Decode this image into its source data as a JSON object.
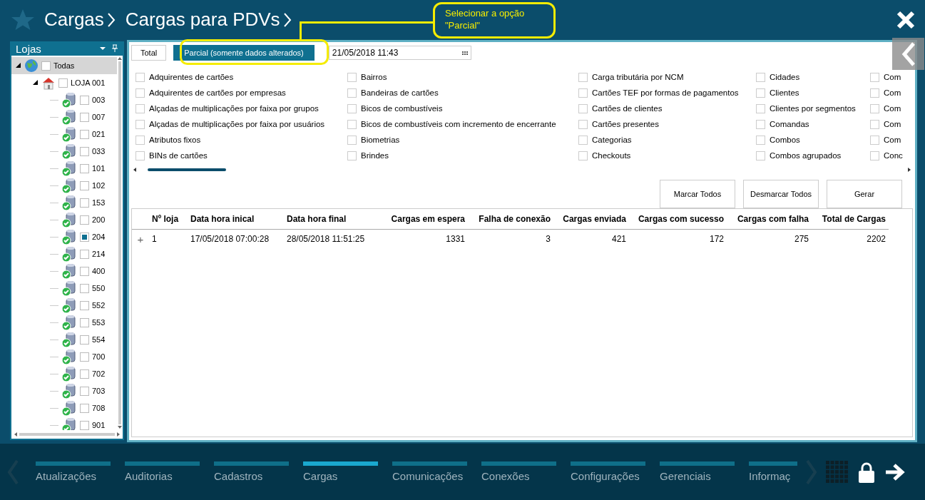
{
  "header": {
    "breadcrumbs": [
      "Cargas",
      "Cargas para PDVs"
    ]
  },
  "callout": {
    "text": "Selecionar a opção\n\"Parcial\""
  },
  "sidebar": {
    "title": "Lojas",
    "tree": [
      {
        "label": "Todas",
        "kind": "globe",
        "checked": false,
        "selected": true,
        "expanded": true,
        "children": [
          {
            "label": "LOJA 001",
            "kind": "house",
            "checked": false,
            "selected": false,
            "expanded": true,
            "children": [
              {
                "label": "003",
                "kind": "pdv",
                "checked": false,
                "selected": false
              },
              {
                "label": "007",
                "kind": "pdv",
                "checked": false,
                "selected": false
              },
              {
                "label": "021",
                "kind": "pdv",
                "checked": false,
                "selected": false
              },
              {
                "label": "033",
                "kind": "pdv",
                "checked": false,
                "selected": false
              },
              {
                "label": "101",
                "kind": "pdv",
                "checked": false,
                "selected": false
              },
              {
                "label": "102",
                "kind": "pdv",
                "checked": false,
                "selected": false
              },
              {
                "label": "153",
                "kind": "pdv",
                "checked": false,
                "selected": false
              },
              {
                "label": "200",
                "kind": "pdv",
                "checked": false,
                "selected": false
              },
              {
                "label": "204",
                "kind": "pdv",
                "checked": true,
                "selected": false
              },
              {
                "label": "214",
                "kind": "pdv",
                "checked": false,
                "selected": false
              },
              {
                "label": "400",
                "kind": "pdv",
                "checked": false,
                "selected": false
              },
              {
                "label": "550",
                "kind": "pdv",
                "checked": false,
                "selected": false
              },
              {
                "label": "552",
                "kind": "pdv",
                "checked": false,
                "selected": false
              },
              {
                "label": "553",
                "kind": "pdv",
                "checked": false,
                "selected": false
              },
              {
                "label": "554",
                "kind": "pdv",
                "checked": false,
                "selected": false
              },
              {
                "label": "700",
                "kind": "pdv",
                "checked": false,
                "selected": false
              },
              {
                "label": "702",
                "kind": "pdv",
                "checked": false,
                "selected": false
              },
              {
                "label": "703",
                "kind": "pdv",
                "checked": false,
                "selected": false
              },
              {
                "label": "708",
                "kind": "pdv",
                "checked": false,
                "selected": false
              },
              {
                "label": "901",
                "kind": "pdv",
                "checked": false,
                "selected": false
              }
            ]
          }
        ]
      }
    ]
  },
  "modes": [
    {
      "label": "Total",
      "selected": false
    },
    {
      "label": "Parcial (somente dados alterados)",
      "selected": true
    }
  ],
  "date_field": {
    "value": "21/05/2018 11:43"
  },
  "options": [
    [
      {
        "label": "Adquirentes de cartões",
        "checked": false
      },
      {
        "label": "Adquirentes de cartões por empresas",
        "checked": false
      },
      {
        "label": "Alçadas de multiplicações por faixa por grupos",
        "checked": false
      },
      {
        "label": "Alçadas de multiplicações por faixa por usuários",
        "checked": false
      },
      {
        "label": "Atributos fixos",
        "checked": false
      },
      {
        "label": "BINs de cartões",
        "checked": false
      }
    ],
    [
      {
        "label": "Bairros",
        "checked": false
      },
      {
        "label": "Bandeiras de cartões",
        "checked": false
      },
      {
        "label": "Bicos de combustíveis",
        "checked": false
      },
      {
        "label": "Bicos de combustíveis com incremento de encerrante",
        "checked": false
      },
      {
        "label": "Biometrias",
        "checked": false
      },
      {
        "label": "Brindes",
        "checked": false
      }
    ],
    [
      {
        "label": "Carga tributária por NCM",
        "checked": false
      },
      {
        "label": "Cartões TEF por formas de pagamentos",
        "checked": false
      },
      {
        "label": "Cartões de clientes",
        "checked": false
      },
      {
        "label": "Cartões presentes",
        "checked": false
      },
      {
        "label": "Categorias",
        "checked": false
      },
      {
        "label": "Checkouts",
        "checked": false
      }
    ],
    [
      {
        "label": "Cidades",
        "checked": false
      },
      {
        "label": "Clientes",
        "checked": false
      },
      {
        "label": "Clientes por segmentos",
        "checked": false
      },
      {
        "label": "Comandas",
        "checked": false
      },
      {
        "label": "Combos",
        "checked": false
      },
      {
        "label": "Combos agrupados",
        "checked": false
      }
    ],
    [
      {
        "label": "Com",
        "checked": false
      },
      {
        "label": "Com",
        "checked": false
      },
      {
        "label": "Com",
        "checked": false
      },
      {
        "label": "Com",
        "checked": false
      },
      {
        "label": "Com",
        "checked": false
      },
      {
        "label": "Conc",
        "checked": false
      }
    ]
  ],
  "buttons": [
    "Marcar Todos",
    "Desmarcar Todos",
    "Gerar"
  ],
  "table": {
    "columns": [
      "Nº loja",
      "Data hora inical",
      "Data hora final",
      "Cargas em espera",
      "Falha de conexão",
      "Cargas enviada",
      "Cargas com sucesso",
      "Cargas com falha",
      "Total de Cargas"
    ],
    "rows": [
      {
        "expander": "+",
        "cells": [
          "1",
          "17/05/2018 07:00:28",
          "28/05/2018 11:51:25",
          "1331",
          "3",
          "421",
          "172",
          "275",
          "2202"
        ]
      }
    ]
  },
  "nav": [
    {
      "label": "Atualizações",
      "selected": false
    },
    {
      "label": "Auditorias",
      "selected": false
    },
    {
      "label": "Cadastros",
      "selected": false
    },
    {
      "label": "Cargas",
      "selected": true
    },
    {
      "label": "Comunicações",
      "selected": false
    },
    {
      "label": "Conexões",
      "selected": false
    },
    {
      "label": "Configurações",
      "selected": false
    },
    {
      "label": "Gerenciais",
      "selected": false
    },
    {
      "label": "Informaç",
      "selected": false
    }
  ]
}
